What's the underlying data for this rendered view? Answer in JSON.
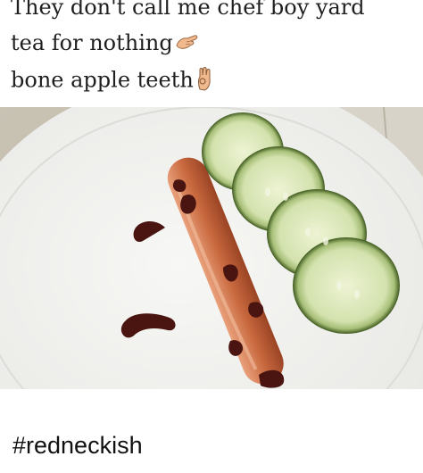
{
  "caption": {
    "line1": "They don't call me chef boy yard",
    "line2": "tea for nothing",
    "line3": "bone apple teeth",
    "emoji1": "pinched-fingers-emoji",
    "emoji2": "ok-hand-emoji"
  },
  "footer": {
    "hashtag": "#redneckish"
  },
  "colors": {
    "background": "#ffffff",
    "text": "#1f1f1f",
    "plate": "#eeeeee",
    "hotdog": "#c0623a",
    "sauce": "#4a1410",
    "cucumber": "#d6e4b8"
  }
}
